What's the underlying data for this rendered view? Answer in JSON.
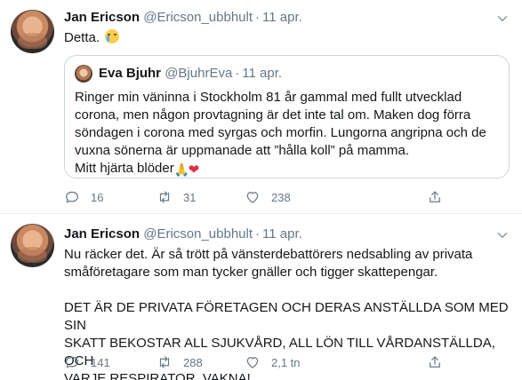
{
  "tweets": [
    {
      "author_name": "Jan Ericson",
      "handle": "@Ericson_ubbhult",
      "date": "11 apr.",
      "text": "Detta.",
      "quoted": {
        "author_name": "Eva Bjuhr",
        "handle": "@BjuhrEva",
        "date": "11 apr.",
        "lines": [
          "Ringer min väninna i Stockholm 81 år gammal med fullt utvecklad",
          "corona, men någon provtagning är det inte tal om. Maken dog förra",
          "söndagen i corona med syrgas och morfin. Lungorna angripna och de",
          "vuxna sönerna är uppmanade att ”hålla koll” på mamma.",
          "Mitt hjärta blöder"
        ]
      },
      "counts": {
        "replies": "16",
        "retweets": "31",
        "likes": "238"
      }
    },
    {
      "author_name": "Jan Ericson",
      "handle": "@Ericson_ubbhult",
      "date": "11 apr.",
      "lines": [
        "Nu räcker det. Är så trött på vänsterdebattörers nedsabling av privata",
        "småföretagare som man tycker gnäller och tigger skattepengar.",
        "",
        "DET ÄR DE PRIVATA FÖRETAGEN OCH DERAS ANSTÄLLDA SOM MED SIN",
        "SKATT BEKOSTAR ALL SJUKVÅRD, ALL LÖN TILL VÅRDANSTÄLLDA, OCH",
        "VARJE RESPIRATOR. VAKNA!"
      ],
      "counts": {
        "replies": "141",
        "retweets": "288",
        "likes": "2,1 tn"
      }
    }
  ],
  "icons": {
    "reply": "reply-icon",
    "retweet": "retweet-icon",
    "like": "heart-icon",
    "share": "share-icon",
    "more": "chevron-down-icon",
    "emoji_cry": "crying-face-emoji",
    "emoji_pray": "folded-hands-emoji",
    "emoji_heart": "red-heart-emoji"
  },
  "colors": {
    "text": "#14171a",
    "muted": "#657786",
    "border": "#e6ecf0",
    "quote_border": "#ccd6dd",
    "heart_emoji": "#dd2e44"
  }
}
